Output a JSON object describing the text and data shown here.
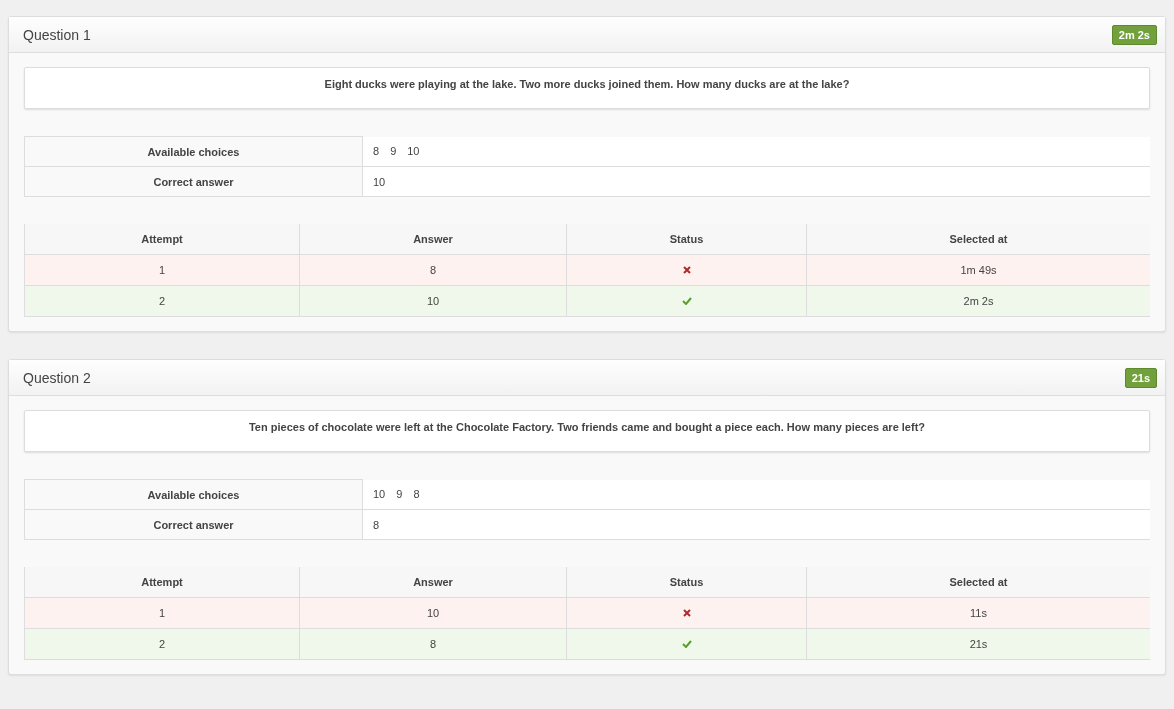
{
  "questions": [
    {
      "title": "Question 1",
      "time": "2m 2s",
      "text": "Eight ducks were playing at the lake. Two more ducks joined them. How many ducks are at the lake?",
      "info": {
        "choices_label": "Available choices",
        "choices": [
          "8",
          "9",
          "10"
        ],
        "answer_label": "Correct answer",
        "answer": "10"
      },
      "attempts_columns": [
        "Attempt",
        "Answer",
        "Status",
        "Selected at"
      ],
      "attempts": [
        {
          "attempt": "1",
          "answer": "8",
          "correct": false,
          "selected_at": "1m 49s"
        },
        {
          "attempt": "2",
          "answer": "10",
          "correct": true,
          "selected_at": "2m 2s"
        }
      ]
    },
    {
      "title": "Question 2",
      "time": "21s",
      "text": "Ten pieces of chocolate were left at the Chocolate Factory. Two friends came and bought a piece each. How many pieces are left?",
      "info": {
        "choices_label": "Available choices",
        "choices": [
          "10",
          "9",
          "8"
        ],
        "answer_label": "Correct answer",
        "answer": "8"
      },
      "attempts_columns": [
        "Attempt",
        "Answer",
        "Status",
        "Selected at"
      ],
      "attempts": [
        {
          "attempt": "1",
          "answer": "10",
          "correct": false,
          "selected_at": "11s"
        },
        {
          "attempt": "2",
          "answer": "8",
          "correct": true,
          "selected_at": "21s"
        }
      ]
    }
  ]
}
